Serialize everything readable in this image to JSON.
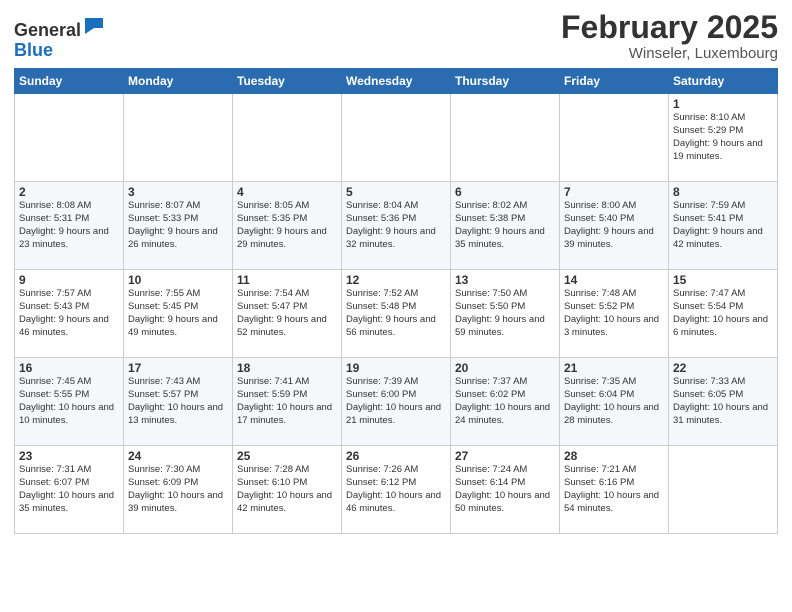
{
  "header": {
    "logo_general": "General",
    "logo_blue": "Blue",
    "month": "February 2025",
    "location": "Winseler, Luxembourg"
  },
  "weekdays": [
    "Sunday",
    "Monday",
    "Tuesday",
    "Wednesday",
    "Thursday",
    "Friday",
    "Saturday"
  ],
  "weeks": [
    [
      {
        "day": "",
        "info": ""
      },
      {
        "day": "",
        "info": ""
      },
      {
        "day": "",
        "info": ""
      },
      {
        "day": "",
        "info": ""
      },
      {
        "day": "",
        "info": ""
      },
      {
        "day": "",
        "info": ""
      },
      {
        "day": "1",
        "info": "Sunrise: 8:10 AM\nSunset: 5:29 PM\nDaylight: 9 hours and 19 minutes."
      }
    ],
    [
      {
        "day": "2",
        "info": "Sunrise: 8:08 AM\nSunset: 5:31 PM\nDaylight: 9 hours and 23 minutes."
      },
      {
        "day": "3",
        "info": "Sunrise: 8:07 AM\nSunset: 5:33 PM\nDaylight: 9 hours and 26 minutes."
      },
      {
        "day": "4",
        "info": "Sunrise: 8:05 AM\nSunset: 5:35 PM\nDaylight: 9 hours and 29 minutes."
      },
      {
        "day": "5",
        "info": "Sunrise: 8:04 AM\nSunset: 5:36 PM\nDaylight: 9 hours and 32 minutes."
      },
      {
        "day": "6",
        "info": "Sunrise: 8:02 AM\nSunset: 5:38 PM\nDaylight: 9 hours and 35 minutes."
      },
      {
        "day": "7",
        "info": "Sunrise: 8:00 AM\nSunset: 5:40 PM\nDaylight: 9 hours and 39 minutes."
      },
      {
        "day": "8",
        "info": "Sunrise: 7:59 AM\nSunset: 5:41 PM\nDaylight: 9 hours and 42 minutes."
      }
    ],
    [
      {
        "day": "9",
        "info": "Sunrise: 7:57 AM\nSunset: 5:43 PM\nDaylight: 9 hours and 46 minutes."
      },
      {
        "day": "10",
        "info": "Sunrise: 7:55 AM\nSunset: 5:45 PM\nDaylight: 9 hours and 49 minutes."
      },
      {
        "day": "11",
        "info": "Sunrise: 7:54 AM\nSunset: 5:47 PM\nDaylight: 9 hours and 52 minutes."
      },
      {
        "day": "12",
        "info": "Sunrise: 7:52 AM\nSunset: 5:48 PM\nDaylight: 9 hours and 56 minutes."
      },
      {
        "day": "13",
        "info": "Sunrise: 7:50 AM\nSunset: 5:50 PM\nDaylight: 9 hours and 59 minutes."
      },
      {
        "day": "14",
        "info": "Sunrise: 7:48 AM\nSunset: 5:52 PM\nDaylight: 10 hours and 3 minutes."
      },
      {
        "day": "15",
        "info": "Sunrise: 7:47 AM\nSunset: 5:54 PM\nDaylight: 10 hours and 6 minutes."
      }
    ],
    [
      {
        "day": "16",
        "info": "Sunrise: 7:45 AM\nSunset: 5:55 PM\nDaylight: 10 hours and 10 minutes."
      },
      {
        "day": "17",
        "info": "Sunrise: 7:43 AM\nSunset: 5:57 PM\nDaylight: 10 hours and 13 minutes."
      },
      {
        "day": "18",
        "info": "Sunrise: 7:41 AM\nSunset: 5:59 PM\nDaylight: 10 hours and 17 minutes."
      },
      {
        "day": "19",
        "info": "Sunrise: 7:39 AM\nSunset: 6:00 PM\nDaylight: 10 hours and 21 minutes."
      },
      {
        "day": "20",
        "info": "Sunrise: 7:37 AM\nSunset: 6:02 PM\nDaylight: 10 hours and 24 minutes."
      },
      {
        "day": "21",
        "info": "Sunrise: 7:35 AM\nSunset: 6:04 PM\nDaylight: 10 hours and 28 minutes."
      },
      {
        "day": "22",
        "info": "Sunrise: 7:33 AM\nSunset: 6:05 PM\nDaylight: 10 hours and 31 minutes."
      }
    ],
    [
      {
        "day": "23",
        "info": "Sunrise: 7:31 AM\nSunset: 6:07 PM\nDaylight: 10 hours and 35 minutes."
      },
      {
        "day": "24",
        "info": "Sunrise: 7:30 AM\nSunset: 6:09 PM\nDaylight: 10 hours and 39 minutes."
      },
      {
        "day": "25",
        "info": "Sunrise: 7:28 AM\nSunset: 6:10 PM\nDaylight: 10 hours and 42 minutes."
      },
      {
        "day": "26",
        "info": "Sunrise: 7:26 AM\nSunset: 6:12 PM\nDaylight: 10 hours and 46 minutes."
      },
      {
        "day": "27",
        "info": "Sunrise: 7:24 AM\nSunset: 6:14 PM\nDaylight: 10 hours and 50 minutes."
      },
      {
        "day": "28",
        "info": "Sunrise: 7:21 AM\nSunset: 6:16 PM\nDaylight: 10 hours and 54 minutes."
      },
      {
        "day": "",
        "info": ""
      }
    ]
  ]
}
